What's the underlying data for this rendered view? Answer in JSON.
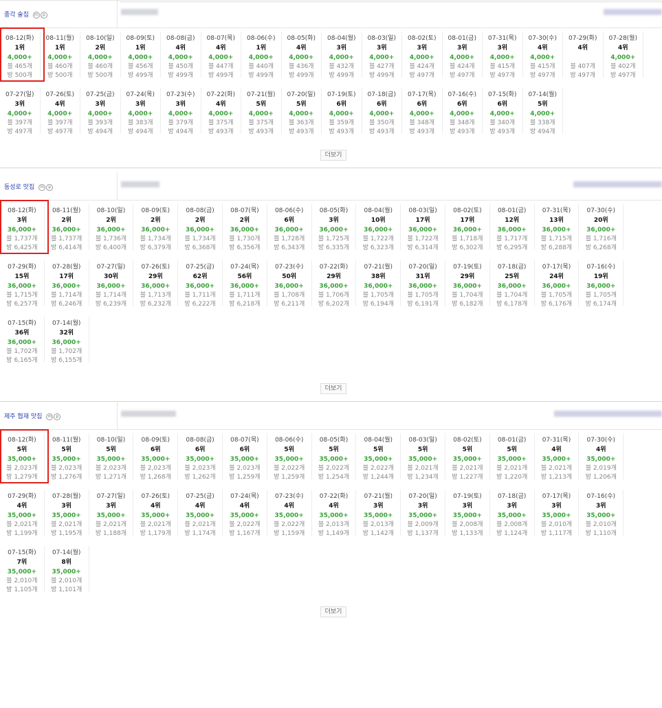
{
  "sections": [
    {
      "keyword": "종각 술집",
      "badges": [
        "m",
        "p"
      ],
      "more_label": "더보기",
      "cells": [
        {
          "date": "08-12(화)",
          "rank": "1위",
          "value": "4,000+",
          "blog": "블 465개",
          "bang": "방 500개"
        },
        {
          "date": "08-11(월)",
          "rank": "1위",
          "value": "4,000+",
          "blog": "블 460개",
          "bang": "방 500개"
        },
        {
          "date": "08-10(일)",
          "rank": "2위",
          "value": "4,000+",
          "blog": "블 460개",
          "bang": "방 500개"
        },
        {
          "date": "08-09(토)",
          "rank": "1위",
          "value": "4,000+",
          "blog": "블 456개",
          "bang": "방 499개"
        },
        {
          "date": "08-08(금)",
          "rank": "4위",
          "value": "4,000+",
          "blog": "블 450개",
          "bang": "방 499개"
        },
        {
          "date": "08-07(목)",
          "rank": "4위",
          "value": "4,000+",
          "blog": "블 447개",
          "bang": "방 499개"
        },
        {
          "date": "08-06(수)",
          "rank": "1위",
          "value": "4,000+",
          "blog": "블 440개",
          "bang": "방 499개"
        },
        {
          "date": "08-05(화)",
          "rank": "4위",
          "value": "4,000+",
          "blog": "블 436개",
          "bang": "방 499개"
        },
        {
          "date": "08-04(월)",
          "rank": "3위",
          "value": "4,000+",
          "blog": "블 432개",
          "bang": "방 499개"
        },
        {
          "date": "08-03(일)",
          "rank": "3위",
          "value": "4,000+",
          "blog": "블 427개",
          "bang": "방 499개"
        },
        {
          "date": "08-02(토)",
          "rank": "3위",
          "value": "4,000+",
          "blog": "블 424개",
          "bang": "방 497개"
        },
        {
          "date": "08-01(금)",
          "rank": "3위",
          "value": "4,000+",
          "blog": "블 424개",
          "bang": "방 497개"
        },
        {
          "date": "07-31(목)",
          "rank": "3위",
          "value": "4,000+",
          "blog": "블 415개",
          "bang": "방 497개"
        },
        {
          "date": "07-30(수)",
          "rank": "4위",
          "value": "4,000+",
          "blog": "블 415개",
          "bang": "방 497개"
        },
        {
          "date": "07-29(화)",
          "rank": "4위",
          "value": "",
          "blog": "블 407개",
          "bang": "방 497개"
        },
        {
          "date": "07-28(월)",
          "rank": "4위",
          "value": "4,000+",
          "blog": "블 402개",
          "bang": "방 497개"
        },
        {
          "date": "07-27(일)",
          "rank": "3위",
          "value": "4,000+",
          "blog": "블 397개",
          "bang": "방 497개"
        },
        {
          "date": "07-26(토)",
          "rank": "4위",
          "value": "4,000+",
          "blog": "블 397개",
          "bang": "방 497개"
        },
        {
          "date": "07-25(금)",
          "rank": "3위",
          "value": "4,000+",
          "blog": "블 393개",
          "bang": "방 494개"
        },
        {
          "date": "07-24(목)",
          "rank": "3위",
          "value": "4,000+",
          "blog": "블 383개",
          "bang": "방 494개"
        },
        {
          "date": "07-23(수)",
          "rank": "3위",
          "value": "4,000+",
          "blog": "블 379개",
          "bang": "방 494개"
        },
        {
          "date": "07-22(화)",
          "rank": "4위",
          "value": "4,000+",
          "blog": "블 375개",
          "bang": "방 493개"
        },
        {
          "date": "07-21(월)",
          "rank": "5위",
          "value": "4,000+",
          "blog": "블 375개",
          "bang": "방 493개"
        },
        {
          "date": "07-20(일)",
          "rank": "5위",
          "value": "4,000+",
          "blog": "블 363개",
          "bang": "방 493개"
        },
        {
          "date": "07-19(토)",
          "rank": "6위",
          "value": "4,000+",
          "blog": "블 359개",
          "bang": "방 493개"
        },
        {
          "date": "07-18(금)",
          "rank": "6위",
          "value": "4,000+",
          "blog": "블 350개",
          "bang": "방 493개"
        },
        {
          "date": "07-17(목)",
          "rank": "6위",
          "value": "4,000+",
          "blog": "블 348개",
          "bang": "방 493개"
        },
        {
          "date": "07-16(수)",
          "rank": "6위",
          "value": "4,000+",
          "blog": "블 348개",
          "bang": "방 493개"
        },
        {
          "date": "07-15(화)",
          "rank": "6위",
          "value": "4,000+",
          "blog": "블 340개",
          "bang": "방 493개"
        },
        {
          "date": "07-14(월)",
          "rank": "5위",
          "value": "4,000+",
          "blog": "블 338개",
          "bang": "방 494개"
        }
      ]
    },
    {
      "keyword": "동성로 맛집",
      "badges": [
        "m",
        "p"
      ],
      "more_label": "더보기",
      "cells": [
        {
          "date": "08-12(화)",
          "rank": "3위",
          "value": "36,000+",
          "blog": "블 1,737개",
          "bang": "방 6,425개"
        },
        {
          "date": "08-11(월)",
          "rank": "2위",
          "value": "36,000+",
          "blog": "블 1,737개",
          "bang": "방 6,414개"
        },
        {
          "date": "08-10(일)",
          "rank": "2위",
          "value": "36,000+",
          "blog": "블 1,736개",
          "bang": "방 6,400개"
        },
        {
          "date": "08-09(토)",
          "rank": "2위",
          "value": "36,000+",
          "blog": "블 1,734개",
          "bang": "방 6,379개"
        },
        {
          "date": "08-08(금)",
          "rank": "2위",
          "value": "36,000+",
          "blog": "블 1,734개",
          "bang": "방 6,368개"
        },
        {
          "date": "08-07(목)",
          "rank": "2위",
          "value": "36,000+",
          "blog": "블 1,730개",
          "bang": "방 6,356개"
        },
        {
          "date": "08-06(수)",
          "rank": "6위",
          "value": "36,000+",
          "blog": "블 1,728개",
          "bang": "방 6,343개"
        },
        {
          "date": "08-05(화)",
          "rank": "3위",
          "value": "36,000+",
          "blog": "블 1,725개",
          "bang": "방 6,335개"
        },
        {
          "date": "08-04(월)",
          "rank": "10위",
          "value": "36,000+",
          "blog": "블 1,722개",
          "bang": "방 6,323개"
        },
        {
          "date": "08-03(일)",
          "rank": "17위",
          "value": "36,000+",
          "blog": "블 1,722개",
          "bang": "방 6,314개"
        },
        {
          "date": "08-02(토)",
          "rank": "17위",
          "value": "36,000+",
          "blog": "블 1,718개",
          "bang": "방 6,302개"
        },
        {
          "date": "08-01(금)",
          "rank": "12위",
          "value": "36,000+",
          "blog": "블 1,717개",
          "bang": "방 6,295개"
        },
        {
          "date": "07-31(목)",
          "rank": "13위",
          "value": "36,000+",
          "blog": "블 1,715개",
          "bang": "방 6,288개"
        },
        {
          "date": "07-30(수)",
          "rank": "20위",
          "value": "36,000+",
          "blog": "블 1,716개",
          "bang": "방 6,268개"
        },
        {
          "date": "07-29(화)",
          "rank": "15위",
          "value": "36,000+",
          "blog": "블 1,715개",
          "bang": "방 6,257개"
        },
        {
          "date": "07-28(월)",
          "rank": "17위",
          "value": "36,000+",
          "blog": "블 1,714개",
          "bang": "방 6,246개"
        },
        {
          "date": "07-27(일)",
          "rank": "30위",
          "value": "36,000+",
          "blog": "블 1,714개",
          "bang": "방 6,239개"
        },
        {
          "date": "07-26(토)",
          "rank": "29위",
          "value": "36,000+",
          "blog": "블 1,713개",
          "bang": "방 6,232개"
        },
        {
          "date": "07-25(금)",
          "rank": "62위",
          "value": "36,000+",
          "blog": "블 1,711개",
          "bang": "방 6,222개"
        },
        {
          "date": "07-24(목)",
          "rank": "56위",
          "value": "36,000+",
          "blog": "블 1,711개",
          "bang": "방 6,218개"
        },
        {
          "date": "07-23(수)",
          "rank": "50위",
          "value": "36,000+",
          "blog": "블 1,708개",
          "bang": "방 6,211개"
        },
        {
          "date": "07-22(화)",
          "rank": "29위",
          "value": "36,000+",
          "blog": "블 1,706개",
          "bang": "방 6,202개"
        },
        {
          "date": "07-21(월)",
          "rank": "38위",
          "value": "36,000+",
          "blog": "블 1,705개",
          "bang": "방 6,194개"
        },
        {
          "date": "07-20(일)",
          "rank": "31위",
          "value": "36,000+",
          "blog": "블 1,705개",
          "bang": "방 6,191개"
        },
        {
          "date": "07-19(토)",
          "rank": "29위",
          "value": "36,000+",
          "blog": "블 1,704개",
          "bang": "방 6,182개"
        },
        {
          "date": "07-18(금)",
          "rank": "25위",
          "value": "36,000+",
          "blog": "블 1,704개",
          "bang": "방 6,178개"
        },
        {
          "date": "07-17(목)",
          "rank": "24위",
          "value": "36,000+",
          "blog": "블 1,705개",
          "bang": "방 6,176개"
        },
        {
          "date": "07-16(수)",
          "rank": "19위",
          "value": "36,000+",
          "blog": "블 1,705개",
          "bang": "방 6,174개"
        },
        {
          "date": "07-15(화)",
          "rank": "36위",
          "value": "36,000+",
          "blog": "블 1,702개",
          "bang": "방 6,165개"
        },
        {
          "date": "07-14(월)",
          "rank": "32위",
          "value": "36,000+",
          "blog": "블 1,702개",
          "bang": "방 6,155개"
        }
      ]
    },
    {
      "keyword": "제주 협재 맛집",
      "badges": [
        "m",
        "p"
      ],
      "more_label": "더보기",
      "cells": [
        {
          "date": "08-12(화)",
          "rank": "5위",
          "value": "35,000+",
          "blog": "블 2,023개",
          "bang": "방 1,279개"
        },
        {
          "date": "08-11(월)",
          "rank": "5위",
          "value": "35,000+",
          "blog": "블 2,023개",
          "bang": "방 1,276개"
        },
        {
          "date": "08-10(일)",
          "rank": "5위",
          "value": "35,000+",
          "blog": "블 2,023개",
          "bang": "방 1,271개"
        },
        {
          "date": "08-09(토)",
          "rank": "6위",
          "value": "35,000+",
          "blog": "블 2,023개",
          "bang": "방 1,268개"
        },
        {
          "date": "08-08(금)",
          "rank": "6위",
          "value": "35,000+",
          "blog": "블 2,023개",
          "bang": "방 1,262개"
        },
        {
          "date": "08-07(목)",
          "rank": "6위",
          "value": "35,000+",
          "blog": "블 2,023개",
          "bang": "방 1,259개"
        },
        {
          "date": "08-06(수)",
          "rank": "5위",
          "value": "35,000+",
          "blog": "블 2,022개",
          "bang": "방 1,259개"
        },
        {
          "date": "08-05(화)",
          "rank": "5위",
          "value": "35,000+",
          "blog": "블 2,022개",
          "bang": "방 1,254개"
        },
        {
          "date": "08-04(월)",
          "rank": "5위",
          "value": "35,000+",
          "blog": "블 2,022개",
          "bang": "방 1,244개"
        },
        {
          "date": "08-03(일)",
          "rank": "5위",
          "value": "35,000+",
          "blog": "블 2,021개",
          "bang": "방 1,234개"
        },
        {
          "date": "08-02(토)",
          "rank": "5위",
          "value": "35,000+",
          "blog": "블 2,021개",
          "bang": "방 1,227개"
        },
        {
          "date": "08-01(금)",
          "rank": "5위",
          "value": "35,000+",
          "blog": "블 2,021개",
          "bang": "방 1,220개"
        },
        {
          "date": "07-31(목)",
          "rank": "4위",
          "value": "35,000+",
          "blog": "블 2,021개",
          "bang": "방 1,213개"
        },
        {
          "date": "07-30(수)",
          "rank": "4위",
          "value": "35,000+",
          "blog": "블 2,019개",
          "bang": "방 1,206개"
        },
        {
          "date": "07-29(화)",
          "rank": "4위",
          "value": "35,000+",
          "blog": "블 2,021개",
          "bang": "방 1,199개"
        },
        {
          "date": "07-28(월)",
          "rank": "3위",
          "value": "35,000+",
          "blog": "블 2,021개",
          "bang": "방 1,195개"
        },
        {
          "date": "07-27(일)",
          "rank": "3위",
          "value": "35,000+",
          "blog": "블 2,021개",
          "bang": "방 1,188개"
        },
        {
          "date": "07-26(토)",
          "rank": "4위",
          "value": "35,000+",
          "blog": "블 2,021개",
          "bang": "방 1,179개"
        },
        {
          "date": "07-25(금)",
          "rank": "4위",
          "value": "35,000+",
          "blog": "블 2,021개",
          "bang": "방 1,174개"
        },
        {
          "date": "07-24(목)",
          "rank": "4위",
          "value": "35,000+",
          "blog": "블 2,022개",
          "bang": "방 1,167개"
        },
        {
          "date": "07-23(수)",
          "rank": "4위",
          "value": "35,000+",
          "blog": "블 2,022개",
          "bang": "방 1,159개"
        },
        {
          "date": "07-22(화)",
          "rank": "4위",
          "value": "35,000+",
          "blog": "블 2,013개",
          "bang": "방 1,149개"
        },
        {
          "date": "07-21(월)",
          "rank": "3위",
          "value": "35,000+",
          "blog": "블 2,013개",
          "bang": "방 1,142개"
        },
        {
          "date": "07-20(일)",
          "rank": "3위",
          "value": "35,000+",
          "blog": "블 2,009개",
          "bang": "방 1,137개"
        },
        {
          "date": "07-19(토)",
          "rank": "3위",
          "value": "35,000+",
          "blog": "블 2,008개",
          "bang": "방 1,133개"
        },
        {
          "date": "07-18(금)",
          "rank": "3위",
          "value": "35,000+",
          "blog": "블 2,008개",
          "bang": "방 1,124개"
        },
        {
          "date": "07-17(목)",
          "rank": "3위",
          "value": "35,000+",
          "blog": "블 2,010개",
          "bang": "방 1,117개"
        },
        {
          "date": "07-16(수)",
          "rank": "3위",
          "value": "35,000+",
          "blog": "블 2,010개",
          "bang": "방 1,110개"
        },
        {
          "date": "07-15(화)",
          "rank": "7위",
          "value": "35,000+",
          "blog": "블 2,010개",
          "bang": "방 1,105개"
        },
        {
          "date": "07-14(월)",
          "rank": "8위",
          "value": "35,000+",
          "blog": "블 2,010개",
          "bang": "방 1,101개"
        }
      ]
    }
  ],
  "colors": {
    "keyword": "#2a3fb0",
    "value": "#3aa13a",
    "highlight": "#e0201c"
  }
}
